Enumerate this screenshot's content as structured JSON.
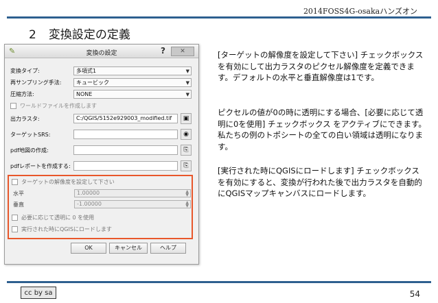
{
  "header": {
    "event_name": "2014FOSS4G-osakaハンズオン"
  },
  "slide": {
    "number": "2",
    "title": "変換設定の定義",
    "page": "54"
  },
  "dialog": {
    "title": "変換の設定",
    "help": "?",
    "close": "✕",
    "fields": {
      "transform_type_label": "変換タイプ:",
      "transform_type_value": "多項式1",
      "resampling_label": "再サンプリング手法:",
      "resampling_value": "キュービック",
      "compression_label": "圧縮方法:",
      "compression_value": "NONE",
      "world_file_label": "ワールドファイルを作成します",
      "output_raster_label": "出力ラスタ:",
      "output_raster_value": "C:/QGIS/5152e929003_modified.tif",
      "target_srs_label": "ターゲットSRS:",
      "pdf_map_label": "pdf地図の作成:",
      "pdf_report_label": "pdfレポートを作成する:"
    },
    "group": {
      "set_resolution_label": "ターゲットの解像度を設定して下さい",
      "horizontal_label": "水平",
      "horizontal_value": "1.00000",
      "vertical_label": "垂直",
      "vertical_value": "-1.00000",
      "use_transparent_label": "必要に応じて透明に 0 を使用",
      "load_in_qgis_label": "実行された時にQGISにロードします"
    },
    "buttons": {
      "ok": "OK",
      "cancel": "キャンセル",
      "help": "ヘルプ"
    }
  },
  "body": {
    "para1": "[ターゲットの解像度を設定して下さい] チェックボックスを有効にして出力ラスタのピクセル解像度を定義できます。デフォルトの水平と垂直解像度は1です。",
    "para2": "ピクセルの値が0の時に透明にする場合、[必要に応じて透明に0を使用] チェックボックス をアクティブにできます。私たちの例のトポシートの全ての白い領域は透明になります。",
    "para3": "[実行された時にQGISにロードします] チェックボックスを有効にすると、変換が行われた後で出力ラスタを自動的にQGISマップキャンバスにロードします。"
  },
  "footer": {
    "license_badge": "cc by sa"
  },
  "colors": {
    "accent_rule": "#2d5f8f",
    "highlight_box": "#e8562a"
  }
}
